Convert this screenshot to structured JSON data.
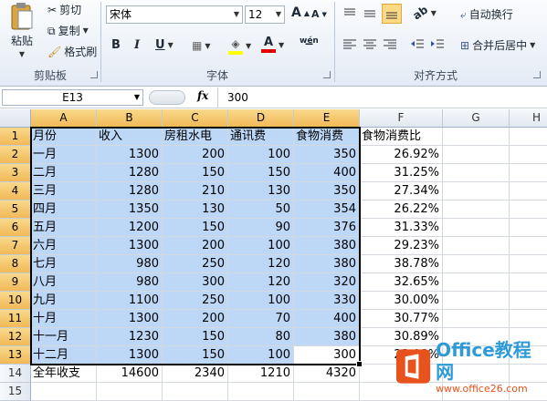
{
  "ribbon": {
    "clipboard": {
      "paste": "粘贴",
      "cut": "剪切",
      "copy": "复制",
      "format_painter": "格式刷",
      "group_label": "剪贴板"
    },
    "font": {
      "font_name": "宋体",
      "font_size": "12",
      "grow": "A",
      "shrink": "A",
      "bold": "B",
      "italic": "I",
      "underline": "U",
      "font_color_letter": "A",
      "phonetic": "wén",
      "group_label": "字体"
    },
    "alignment": {
      "wrap_text": "自动换行",
      "merge_center": "合并后居中",
      "group_label": "对齐方式"
    }
  },
  "formula_bar": {
    "name_box": "E13",
    "fx": "fx",
    "value": "300"
  },
  "columns": [
    "A",
    "B",
    "C",
    "D",
    "E",
    "F",
    "G",
    "H"
  ],
  "rows": [
    "1",
    "2",
    "3",
    "4",
    "5",
    "6",
    "7",
    "8",
    "9",
    "10",
    "11",
    "12",
    "13",
    "14",
    "15"
  ],
  "table": [
    [
      "月份",
      "收入",
      "房租水电",
      "通讯费",
      "食物消费",
      "食物消费比"
    ],
    [
      "一月",
      "1300",
      "200",
      "100",
      "350",
      "26.92%"
    ],
    [
      "二月",
      "1280",
      "150",
      "150",
      "400",
      "31.25%"
    ],
    [
      "三月",
      "1280",
      "210",
      "130",
      "350",
      "27.34%"
    ],
    [
      "四月",
      "1350",
      "130",
      "50",
      "354",
      "26.22%"
    ],
    [
      "五月",
      "1200",
      "150",
      "90",
      "376",
      "31.33%"
    ],
    [
      "六月",
      "1300",
      "200",
      "100",
      "380",
      "29.23%"
    ],
    [
      "七月",
      "980",
      "250",
      "120",
      "380",
      "38.78%"
    ],
    [
      "八月",
      "980",
      "300",
      "120",
      "320",
      "32.65%"
    ],
    [
      "九月",
      "1100",
      "250",
      "100",
      "330",
      "30.00%"
    ],
    [
      "十月",
      "1300",
      "200",
      "70",
      "400",
      "30.77%"
    ],
    [
      "十一月",
      "1230",
      "150",
      "80",
      "380",
      "30.89%"
    ],
    [
      "十二月",
      "1300",
      "150",
      "100",
      "300",
      "23.08%"
    ],
    [
      "全年收支",
      "14600",
      "2340",
      "1210",
      "4320",
      ""
    ]
  ],
  "watermark": {
    "brand": "Office教程网",
    "url": "www.office26.com"
  }
}
